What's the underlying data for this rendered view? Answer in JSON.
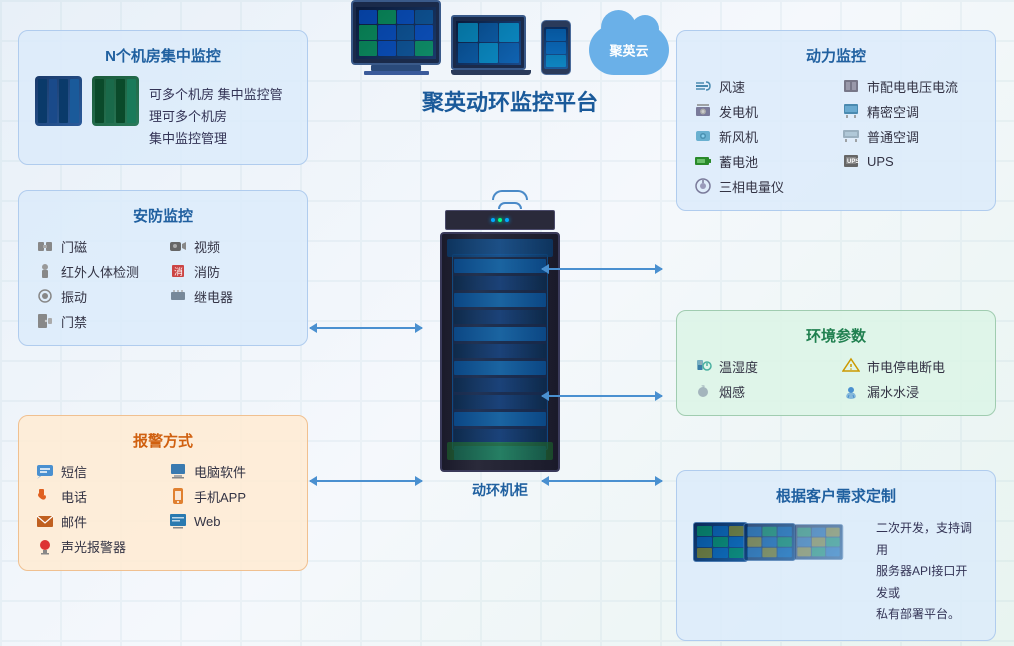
{
  "platform": {
    "cloud_label": "聚英云",
    "title": "聚英动环监控平台",
    "cabinet_label": "动环机柜"
  },
  "top_left": {
    "title": "N个机房集中监控",
    "desc": "可多个机房\n集中监控管理"
  },
  "security": {
    "title": "安防监控",
    "items": [
      {
        "icon": "🔒",
        "label": "门磁"
      },
      {
        "icon": "📹",
        "label": "视频"
      },
      {
        "icon": "🚶",
        "label": "红外人体检测"
      },
      {
        "icon": "🔥",
        "label": "消防"
      },
      {
        "icon": "📳",
        "label": "振动"
      },
      {
        "icon": "⚡",
        "label": "继电器"
      },
      {
        "icon": "🚪",
        "label": "门禁"
      }
    ]
  },
  "alarm": {
    "title": "报警方式",
    "items": [
      {
        "icon": "💬",
        "label": "短信"
      },
      {
        "icon": "🖥️",
        "label": "电脑软件"
      },
      {
        "icon": "📞",
        "label": "电话"
      },
      {
        "icon": "📱",
        "label": "手机APP"
      },
      {
        "icon": "✉️",
        "label": "邮件"
      },
      {
        "icon": "🌐",
        "label": "Web"
      },
      {
        "icon": "🔔",
        "label": "声光报警器"
      }
    ]
  },
  "power": {
    "title": "动力监控",
    "items": [
      {
        "icon": "🌬️",
        "label": "风速"
      },
      {
        "icon": "⚡",
        "label": "市配电电压电流"
      },
      {
        "icon": "⚙️",
        "label": "发电机"
      },
      {
        "icon": "❄️",
        "label": "精密空调"
      },
      {
        "icon": "💨",
        "label": "新风机"
      },
      {
        "icon": "🌡️",
        "label": "普通空调"
      },
      {
        "icon": "🔋",
        "label": "蓄电池"
      },
      {
        "icon": "🔌",
        "label": "UPS"
      },
      {
        "icon": "📊",
        "label": "三相电量仪"
      }
    ]
  },
  "env": {
    "title": "环境参数",
    "items": [
      {
        "icon": "🌡️",
        "label": "温湿度"
      },
      {
        "icon": "⚡",
        "label": "市电停电断电"
      },
      {
        "icon": "🔥",
        "label": "烟感"
      },
      {
        "icon": "💧",
        "label": "漏水水浸"
      }
    ]
  },
  "custom": {
    "title": "根据客户需求定制",
    "desc": "二次开发，支持调用\n服务器API接口开发或\n私有部署平台。"
  }
}
